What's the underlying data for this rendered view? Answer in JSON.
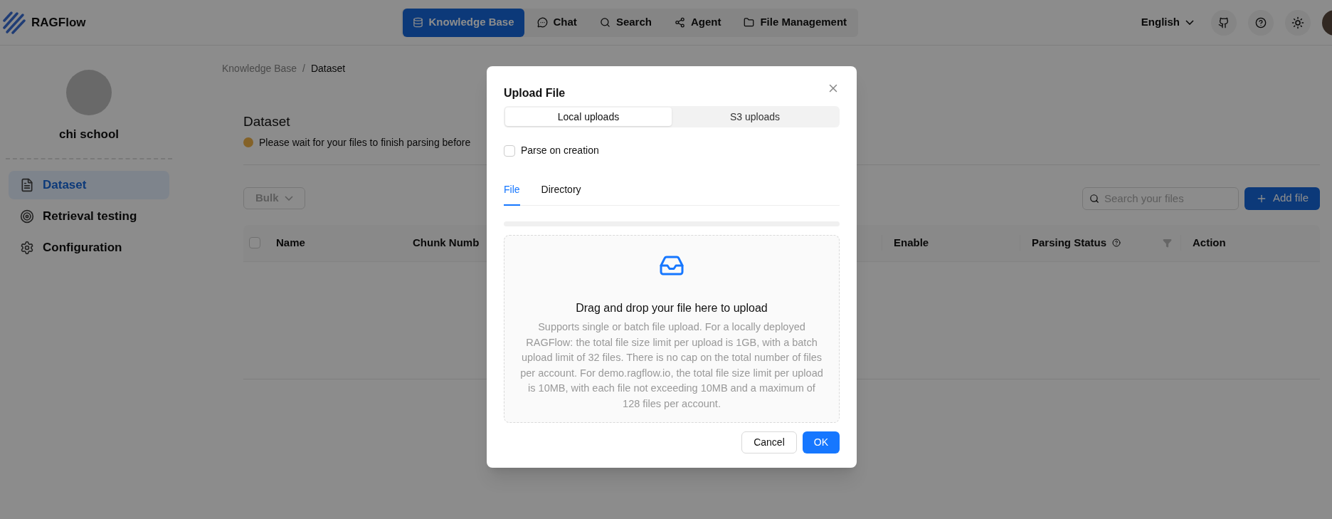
{
  "header": {
    "brand": "RAGFlow",
    "nav": [
      {
        "label": "Knowledge Base",
        "selected": true
      },
      {
        "label": "Chat",
        "selected": false
      },
      {
        "label": "Search",
        "selected": false
      },
      {
        "label": "Agent",
        "selected": false
      },
      {
        "label": "File Management",
        "selected": false
      }
    ],
    "language": "English"
  },
  "sidebar": {
    "name": "chi school",
    "items": [
      {
        "label": "Dataset",
        "selected": true
      },
      {
        "label": "Retrieval testing",
        "selected": false
      },
      {
        "label": "Configuration",
        "selected": false
      }
    ]
  },
  "breadcrumb": {
    "separator": "/",
    "items": [
      {
        "label": "Knowledge Base",
        "current": false
      },
      {
        "label": "Dataset",
        "current": true
      }
    ]
  },
  "page": {
    "title": "Dataset",
    "notice": "Please wait for your files to finish parsing before"
  },
  "toolbar": {
    "bulk": "Bulk",
    "search_placeholder": "Search your files",
    "add": "Add file"
  },
  "table": {
    "select_all": {
      "checked": false
    },
    "columns_left": [
      {
        "label": "Name"
      },
      {
        "label": "Chunk Numb"
      }
    ],
    "columns_right": [
      {
        "label": "Enable",
        "kind": "plain"
      },
      {
        "label": "Parsing Status",
        "kind": "status"
      },
      {
        "label": "Action",
        "kind": "plain"
      }
    ]
  },
  "dialog": {
    "title": "Upload File",
    "sources": [
      {
        "label": "Local uploads",
        "selected": true
      },
      {
        "label": "S3 uploads",
        "selected": false
      }
    ],
    "parse_on_creation": {
      "label": "Parse on creation",
      "checked": false
    },
    "tabs": [
      {
        "label": "File",
        "selected": true
      },
      {
        "label": "Directory",
        "selected": false
      }
    ],
    "upload_progress": {
      "level": 0
    },
    "dropzone": {
      "title": "Drag and drop your file here to upload",
      "description": "Supports single or batch file upload. For a locally deployed RAGFlow: the total file size limit per upload is 1GB, with a batch upload limit of 32 files. There is no cap on the total number of files per account. For demo.ragflow.io, the total file size limit per upload is 10MB, with each file not exceeding 10MB and a maximum of 128 files per account."
    },
    "buttons": [
      {
        "label": "Cancel",
        "kind": "secondary"
      },
      {
        "label": "OK",
        "kind": "primary"
      }
    ]
  }
}
